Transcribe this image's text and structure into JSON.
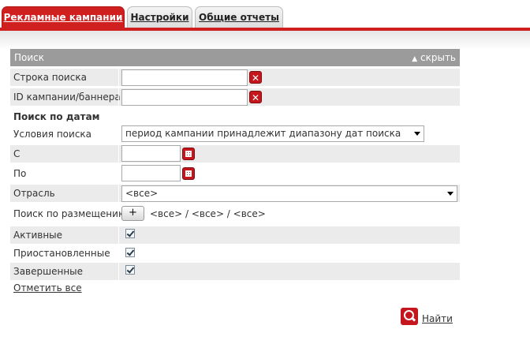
{
  "tabs": [
    "Рекламные кампании",
    "Настройки",
    "Общие отчеты"
  ],
  "panel": {
    "title": "Поиск",
    "hide_label": "скрыть"
  },
  "fields": {
    "search_string": {
      "label": "Строка поиска",
      "value": ""
    },
    "id_field": {
      "label": "ID кампании/баннера",
      "value": ""
    }
  },
  "date_section": {
    "title": "Поиск по датам",
    "conditions_label": "Условия поиска",
    "conditions_value": "период кампании принадлежит диапазону дат поиска",
    "from_label": "С",
    "to_label": "По"
  },
  "industry": {
    "label": "Отрасль",
    "value": "<все>"
  },
  "placement": {
    "label": "Поиск по размещению",
    "button": "+",
    "value": "<все> / <все> / <все>"
  },
  "statuses": [
    {
      "label": "Активные",
      "checked": true
    },
    {
      "label": "Приостановленные",
      "checked": true
    },
    {
      "label": "Завершенные",
      "checked": true
    }
  ],
  "check_all": "Отметить все",
  "find": "Найти"
}
